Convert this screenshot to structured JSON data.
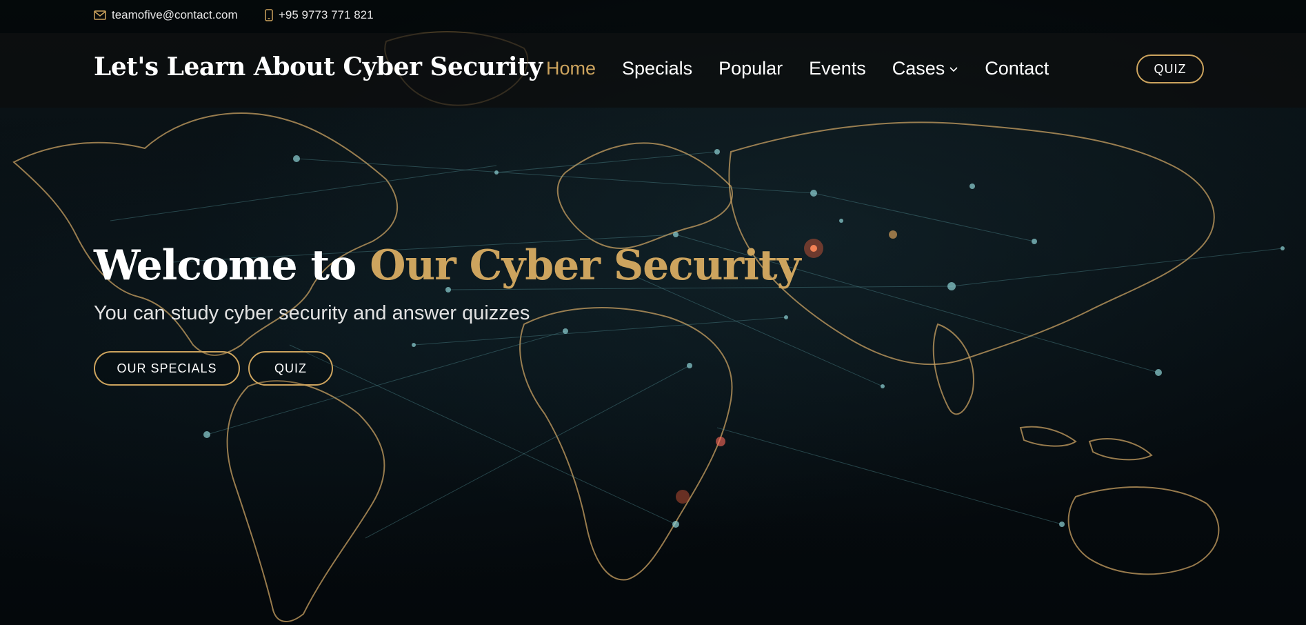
{
  "topbar": {
    "email": "teamofive@contact.com",
    "email_icon": "envelope-icon",
    "phone": "+95 9773 771 821",
    "phone_icon": "phone-icon"
  },
  "header": {
    "logo": "Let's Learn About Cyber Security",
    "nav": [
      {
        "label": "Home",
        "active": true
      },
      {
        "label": "Specials",
        "active": false
      },
      {
        "label": "Popular",
        "active": false
      },
      {
        "label": "Events",
        "active": false
      },
      {
        "label": "Cases",
        "active": false,
        "dropdown": true
      },
      {
        "label": "Contact",
        "active": false
      }
    ],
    "quiz_button": "QUIZ"
  },
  "hero": {
    "title_prefix": "Welcome to",
    "title_accent": "Our Cyber Security",
    "subtitle": "You can study cyber security and answer quizzes",
    "buttons": {
      "specials": "OUR SPECIALS",
      "quiz": "QUIZ"
    }
  },
  "colors": {
    "accent": "#cda45e",
    "background": "#050a0d",
    "text": "#ffffff"
  },
  "background_image": "world-map-network-icon"
}
